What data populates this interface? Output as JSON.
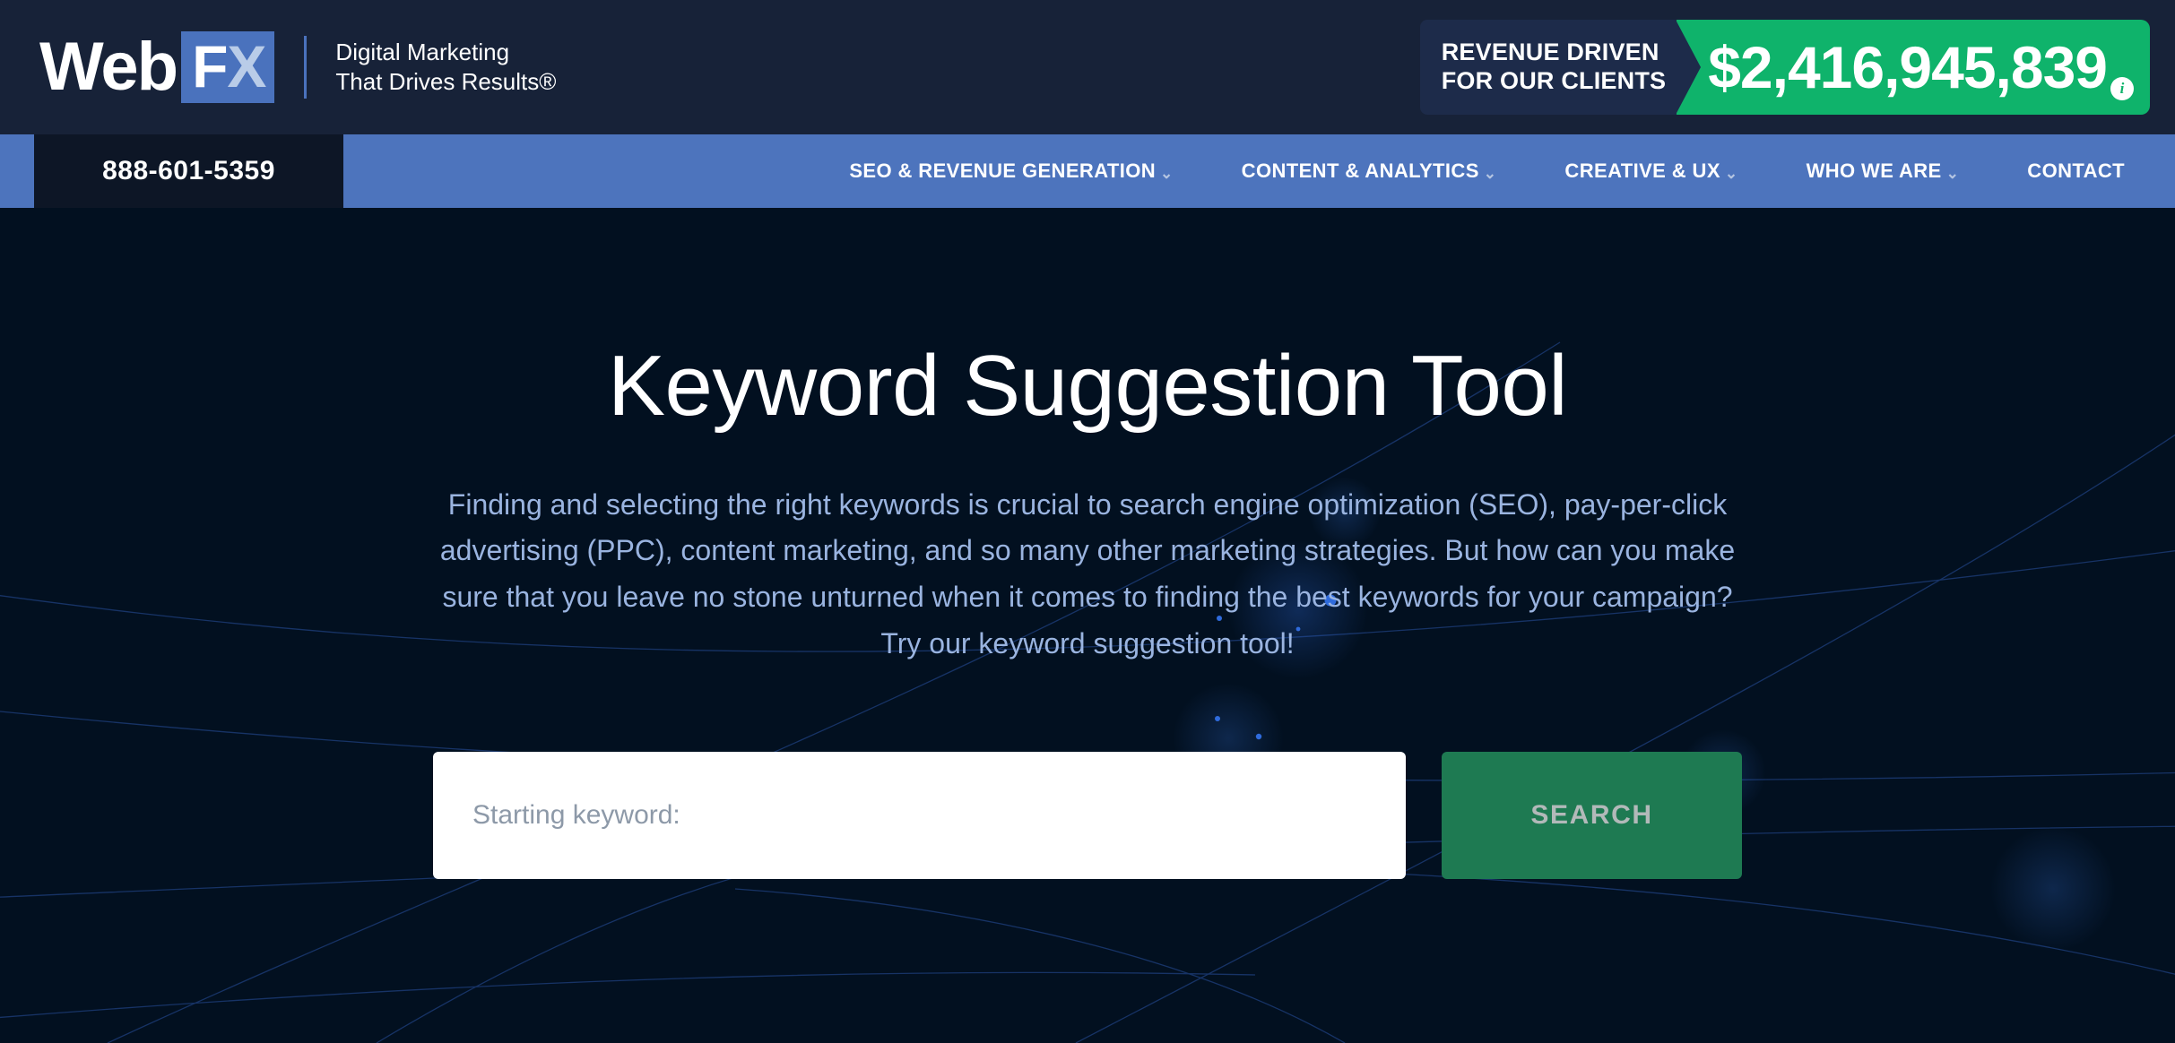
{
  "topbar": {
    "logo": {
      "web": "Web",
      "fx_f": "F",
      "fx_x": "X"
    },
    "tagline": "Digital Marketing\nThat Drives Results®",
    "revenue": {
      "label_line1": "REVENUE DRIVEN",
      "label_line2": "FOR OUR CLIENTS",
      "amount": "$2,416,945,839",
      "info_glyph": "i"
    }
  },
  "nav": {
    "phone": "888-601-5359",
    "items": [
      {
        "label": "SEO & REVENUE GENERATION",
        "caret": "⌄",
        "has_caret": true
      },
      {
        "label": "CONTENT & ANALYTICS",
        "caret": "⌄",
        "has_caret": true
      },
      {
        "label": "CREATIVE & UX",
        "caret": "⌄",
        "has_caret": true
      },
      {
        "label": "WHO WE ARE",
        "caret": "⌄",
        "has_caret": true
      },
      {
        "label": "CONTACT",
        "caret": "",
        "has_caret": false
      }
    ]
  },
  "hero": {
    "title": "Keyword Suggestion Tool",
    "description": "Finding and selecting the right keywords is crucial to search engine optimization (SEO), pay-per-click advertising (PPC), content marketing, and so many other marketing strategies. But how can you make sure that you leave no stone unturned when it comes to finding the best keywords for your campaign? Try our keyword suggestion tool!",
    "search": {
      "placeholder": "Starting keyword:",
      "value": "",
      "button_label": "SEARCH"
    }
  },
  "colors": {
    "topbar_bg": "#172238",
    "nav_bg": "#4d74bd",
    "phone_bg": "#0d1626",
    "hero_bg": "#021020",
    "brand_blue": "#4a72bd",
    "revenue_green": "#0fb36b",
    "revenue_navy": "#1d2b4a",
    "search_green": "#1e7a52",
    "desc_text": "#9ab4e0"
  }
}
